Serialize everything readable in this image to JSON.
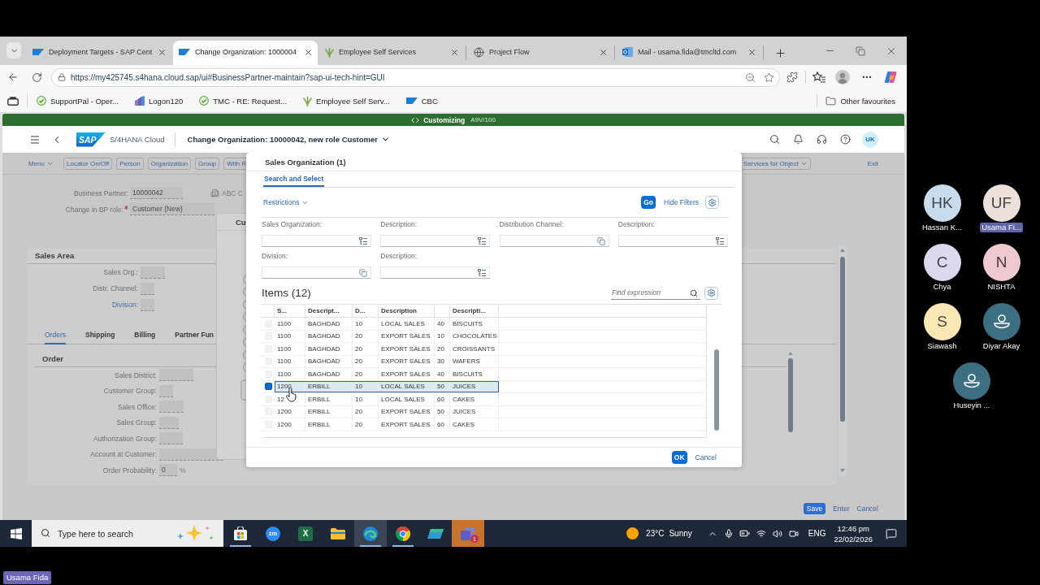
{
  "browser": {
    "tabs": [
      {
        "kind": "sap",
        "title": "Deployment Targets - SAP Cent",
        "selected": false
      },
      {
        "kind": "sap",
        "title": "Change Organization: 1000004",
        "selected": true
      },
      {
        "kind": "plant",
        "title": "Employee Self Services",
        "selected": false
      },
      {
        "kind": "globe",
        "title": "Project Flow",
        "selected": false
      },
      {
        "kind": "mail",
        "title": "Mail - usama.fida@tmcltd.com",
        "selected": false
      }
    ],
    "address": "https://my425745.s4hana.cloud.sap/ui#BusinessPartner-maintain?sap-ui-tech-hint=GUI",
    "bookmarks": [
      {
        "kind": "check",
        "label": "SupportPal - Oper..."
      },
      {
        "kind": "bars",
        "label": "Logon120"
      },
      {
        "kind": "check",
        "label": "TMC - RE: Request..."
      },
      {
        "kind": "plant",
        "label": "Employee Self Serv..."
      },
      {
        "kind": "sap",
        "label": "CBC"
      }
    ],
    "other_favourites": "Other favourites"
  },
  "sap": {
    "system_bar": {
      "context": "Customizing",
      "system": "A9V/100"
    },
    "shell": {
      "logo": "SAP",
      "product": "S/4HANA Cloud",
      "title": "Change Organization: 10000042, new role Customer",
      "user_initials": "UK"
    },
    "toolbar": [
      {
        "kind": "menu",
        "label": "Menu"
      },
      {
        "kind": "button",
        "label": "Locator On/Off"
      },
      {
        "kind": "button",
        "label": "Person"
      },
      {
        "kind": "button",
        "label": "Organization"
      },
      {
        "kind": "button",
        "label": "Group"
      },
      {
        "kind": "button",
        "label": "With R"
      }
    ],
    "toolbar_right": [
      {
        "kind": "menu_button",
        "label": "Services for Object"
      },
      {
        "kind": "link",
        "label": "Exit"
      }
    ],
    "header_fields": [
      {
        "label": "Business Partner:",
        "value": "10000042",
        "required": false
      },
      {
        "label": "Change in BP role:",
        "value": "Customer (New)",
        "required": true
      }
    ],
    "partner_name": "ABC C",
    "sales_area": {
      "title": "Sales Area",
      "fields": [
        {
          "kind": "text",
          "label": "Sales Org.:"
        },
        {
          "kind": "text",
          "label": "Distr. Channel:"
        },
        {
          "kind": "link",
          "label": "Division:"
        }
      ]
    },
    "tabs": [
      {
        "label": "Orders",
        "selected": true
      },
      {
        "label": "Shipping",
        "selected": false
      },
      {
        "label": "Billing",
        "selected": false
      },
      {
        "label": "Partner Fun",
        "selected": false
      }
    ],
    "order": {
      "title": "Order",
      "fields": [
        {
          "label": "Sales District:"
        },
        {
          "label": "Customer Group:"
        },
        {
          "label": "Sales Office:"
        },
        {
          "label": "Sales Group:"
        },
        {
          "label": "Authorization Group:"
        },
        {
          "label": "Account at Customer:"
        },
        {
          "label": "Order Probability:",
          "value": "0",
          "unit": "%"
        }
      ]
    },
    "footer_buttons": [
      {
        "kind": "primary",
        "label": "Save"
      },
      {
        "kind": "plain",
        "label": "Enter"
      },
      {
        "kind": "plain",
        "label": "Cancel"
      }
    ],
    "background_dialog": {
      "title": "Cu"
    }
  },
  "dialog": {
    "title": "Sales Organization (1)",
    "tabs": [
      {
        "label": "Search and Select",
        "selected": true
      }
    ],
    "restrictions": "Restrictions",
    "go": "Go",
    "hide_filters": "Hide Filters",
    "filters": [
      {
        "kind": "list",
        "label": "Sales Organization:"
      },
      {
        "kind": "list",
        "label": "Description:"
      },
      {
        "kind": "copy",
        "label": "Distribution Channel:"
      },
      {
        "kind": "list",
        "label": "Description:"
      },
      {
        "kind": "copy",
        "label": "Division:"
      },
      {
        "kind": "list",
        "label": "Description:"
      }
    ],
    "items_title": "Items (12)",
    "search": {
      "placeholder": "Find expression"
    },
    "table": {
      "columns": [
        {
          "label": "S..."
        },
        {
          "label": "Descript..."
        },
        {
          "label": "D..."
        },
        {
          "label": "Description"
        },
        {},
        {
          "label": "Descripti..."
        }
      ],
      "rows": [
        {
          "cells": [
            "1100",
            "BAGHDAD",
            "10",
            "LOCAL SALES",
            "40",
            "BISCUITS"
          ],
          "selected": false
        },
        {
          "cells": [
            "1100",
            "BAGHDAD",
            "20",
            "EXPORT SALES",
            "10",
            "CHOCOLATES"
          ],
          "selected": false
        },
        {
          "cells": [
            "1100",
            "BAGHDAD",
            "20",
            "EXPORT SALES",
            "20",
            "CROISSANTS"
          ],
          "selected": false
        },
        {
          "cells": [
            "1100",
            "BAGHDAD",
            "20",
            "EXPORT SALES",
            "30",
            "WAFERS"
          ],
          "selected": false
        },
        {
          "cells": [
            "1100",
            "BAGHDAD",
            "20",
            "EXPORT SALES",
            "40",
            "BISCUITS"
          ],
          "selected": false
        },
        {
          "cells": [
            "1200",
            "ERBILL",
            "10",
            "LOCAL SALES",
            "50",
            "JUICES"
          ],
          "selected": true
        },
        {
          "cells": [
            "12",
            "ERBILL",
            "10",
            "LOCAL SALES",
            "60",
            "CAKES"
          ],
          "selected": false
        },
        {
          "cells": [
            "1200",
            "ERBILL",
            "20",
            "EXPORT SALES",
            "50",
            "JUICES"
          ],
          "selected": false
        },
        {
          "cells": [
            "1200",
            "ERBILL",
            "20",
            "EXPORT SALES",
            "60",
            "CAKES"
          ],
          "selected": false
        }
      ]
    },
    "buttons": [
      {
        "kind": "primary",
        "label": "OK"
      },
      {
        "kind": "plain",
        "label": "Cancel"
      }
    ]
  },
  "taskbar": {
    "search": {
      "placeholder": "Type here to search"
    },
    "apps": [
      {
        "kind": "bag",
        "running": true,
        "selected": false,
        "attention": false
      },
      {
        "kind": "round_glyph",
        "glyph": "zm",
        "running": false,
        "selected": false,
        "attention": false
      },
      {
        "kind": "square_glyph",
        "glyph": "X",
        "running": false,
        "selected": false,
        "attention": false
      },
      {
        "kind": "folder",
        "running": false,
        "selected": false,
        "attention": false
      },
      {
        "kind": "wave",
        "running": true,
        "selected": true,
        "attention": false
      },
      {
        "kind": "ring",
        "running": true,
        "selected": false,
        "attention": false
      },
      {
        "kind": "slant",
        "running": false,
        "selected": false,
        "attention": false
      },
      {
        "kind": "people",
        "badge": "1",
        "running": false,
        "selected": false,
        "attention": true
      }
    ],
    "weather": {
      "temperature": "23°C",
      "condition": "Sunny"
    },
    "language": "ENG",
    "time": "12:46 pm",
    "date": "22/02/2026"
  },
  "meeting": {
    "participants": [
      {
        "kind": "initials",
        "initials": "HK",
        "name": "Hassan K...",
        "color": "#c9dcec",
        "highlighted": false
      },
      {
        "kind": "initials",
        "initials": "UF",
        "name": "Usama Fi...",
        "color": "#ebe0dc",
        "highlighted": true
      },
      {
        "kind": "initials",
        "initials": "C",
        "name": "Chya",
        "color": "#dcd9ee",
        "highlighted": false
      },
      {
        "kind": "initials",
        "initials": "N",
        "name": "NISHTA",
        "color": "#efc9d0",
        "highlighted": false
      },
      {
        "kind": "initials",
        "initials": "S",
        "name": "Siawash",
        "color": "#fae8b4",
        "highlighted": false
      },
      {
        "kind": "silhouette",
        "name": "Diyar Akay",
        "color": "#3c6f82",
        "highlighted": false
      },
      {
        "kind": "silhouette",
        "name": "Huseyin ...",
        "color": "#3c6f82",
        "highlighted": false
      }
    ],
    "presenter": "Usama Fida"
  }
}
